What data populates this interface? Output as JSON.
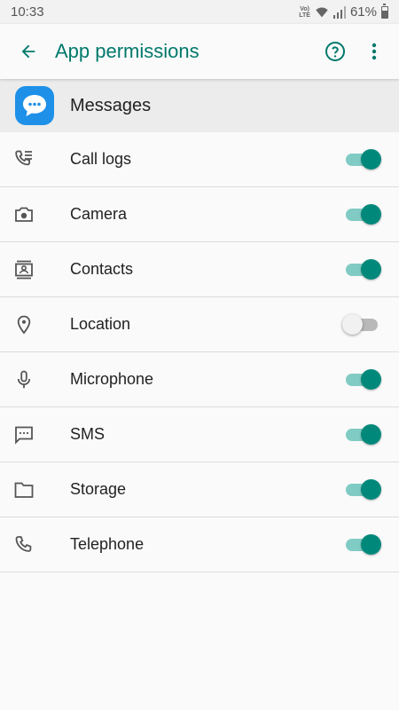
{
  "status_bar": {
    "time": "10:33",
    "network_label": "Vo) LTE",
    "battery_percent": "61%",
    "battery_level": 0.61
  },
  "app_bar": {
    "title": "App permissions",
    "back_icon": "arrow-back-icon",
    "help_icon": "help-icon",
    "menu_icon": "more-vert-icon"
  },
  "app": {
    "name": "Messages",
    "icon": "messages-app-icon",
    "icon_color": "#1e90e8"
  },
  "colors": {
    "accent": "#00796b",
    "switch_on": "#00897b",
    "switch_on_track": "#80cbc4"
  },
  "permissions": [
    {
      "label": "Call logs",
      "icon": "call-log-icon",
      "enabled": true
    },
    {
      "label": "Camera",
      "icon": "camera-icon",
      "enabled": true
    },
    {
      "label": "Contacts",
      "icon": "contacts-icon",
      "enabled": true
    },
    {
      "label": "Location",
      "icon": "location-icon",
      "enabled": false
    },
    {
      "label": "Microphone",
      "icon": "microphone-icon",
      "enabled": true
    },
    {
      "label": "SMS",
      "icon": "sms-icon",
      "enabled": true
    },
    {
      "label": "Storage",
      "icon": "folder-icon",
      "enabled": true
    },
    {
      "label": "Telephone",
      "icon": "phone-icon",
      "enabled": true
    }
  ]
}
